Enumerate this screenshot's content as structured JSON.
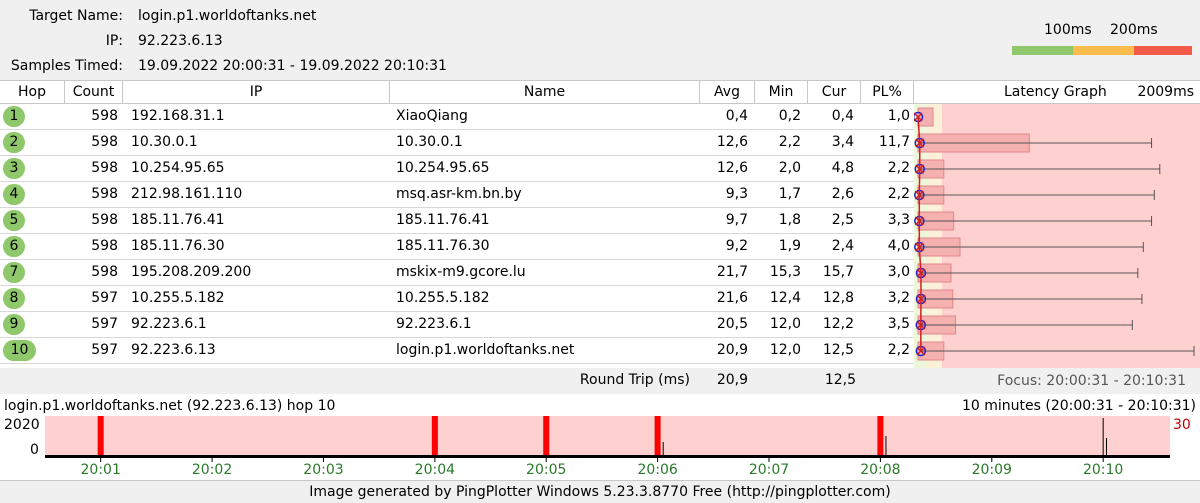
{
  "info": {
    "target_label": "Target Name:",
    "target_value": "login.p1.worldoftanks.net",
    "ip_label": "IP:",
    "ip_value": "92.223.6.13",
    "samples_label": "Samples Timed:",
    "samples_value": "19.09.2022 20:00:31 - 19.09.2022 20:10:31"
  },
  "scale": {
    "label_100": "100ms",
    "label_200": "200ms",
    "colors": {
      "green": "#8fc86a",
      "yellow": "#fbbc4c",
      "red": "#f25a4a"
    }
  },
  "headers": {
    "hop": "Hop",
    "count": "Count",
    "ip": "IP",
    "name": "Name",
    "avg": "Avg",
    "min": "Min",
    "cur": "Cur",
    "pl": "PL%",
    "graph": "Latency Graph",
    "graph_max": "2009ms"
  },
  "rows": [
    {
      "hop": "1",
      "count": "598",
      "ip": "192.168.31.1",
      "name": "XiaoQiang",
      "avg": "0,4",
      "min": "0,2",
      "cur": "0,4",
      "pl": "1,0",
      "pl_pct": 1.0,
      "avg_ms": 0.4,
      "cur_ms": 0.4,
      "max_ms": 0.4
    },
    {
      "hop": "2",
      "count": "598",
      "ip": "10.30.0.1",
      "name": "10.30.0.1",
      "avg": "12,6",
      "min": "2,2",
      "cur": "3,4",
      "pl": "11,7",
      "pl_pct": 11.7,
      "avg_ms": 12.6,
      "cur_ms": 3.4,
      "max_ms": 1700
    },
    {
      "hop": "3",
      "count": "598",
      "ip": "10.254.95.65",
      "name": "10.254.95.65",
      "avg": "12,6",
      "min": "2,0",
      "cur": "4,8",
      "pl": "2,2",
      "pl_pct": 2.2,
      "avg_ms": 12.6,
      "cur_ms": 4.8,
      "max_ms": 1760
    },
    {
      "hop": "4",
      "count": "598",
      "ip": "212.98.161.110",
      "name": "msq.asr-km.bn.by",
      "avg": "9,3",
      "min": "1,7",
      "cur": "2,6",
      "pl": "2,2",
      "pl_pct": 2.2,
      "avg_ms": 9.3,
      "cur_ms": 2.6,
      "max_ms": 1720
    },
    {
      "hop": "5",
      "count": "598",
      "ip": "185.11.76.41",
      "name": "185.11.76.41",
      "avg": "9,7",
      "min": "1,8",
      "cur": "2,5",
      "pl": "3,3",
      "pl_pct": 3.3,
      "avg_ms": 9.7,
      "cur_ms": 2.5,
      "max_ms": 1700
    },
    {
      "hop": "6",
      "count": "598",
      "ip": "185.11.76.30",
      "name": "185.11.76.30",
      "avg": "9,2",
      "min": "1,9",
      "cur": "2,4",
      "pl": "4,0",
      "pl_pct": 4.0,
      "avg_ms": 9.2,
      "cur_ms": 2.4,
      "max_ms": 1640
    },
    {
      "hop": "7",
      "count": "598",
      "ip": "195.208.209.200",
      "name": "mskix-m9.gcore.lu",
      "avg": "21,7",
      "min": "15,3",
      "cur": "15,7",
      "pl": "3,0",
      "pl_pct": 3.0,
      "avg_ms": 21.7,
      "cur_ms": 15.7,
      "max_ms": 1600
    },
    {
      "hop": "8",
      "count": "597",
      "ip": "10.255.5.182",
      "name": "10.255.5.182",
      "avg": "21,6",
      "min": "12,4",
      "cur": "12,8",
      "pl": "3,2",
      "pl_pct": 3.2,
      "avg_ms": 21.6,
      "cur_ms": 12.8,
      "max_ms": 1630
    },
    {
      "hop": "9",
      "count": "597",
      "ip": "92.223.6.1",
      "name": "92.223.6.1",
      "avg": "20,5",
      "min": "12,0",
      "cur": "12,2",
      "pl": "3,5",
      "pl_pct": 3.5,
      "avg_ms": 20.5,
      "cur_ms": 12.2,
      "max_ms": 1560
    },
    {
      "hop": "10",
      "count": "597",
      "ip": "92.223.6.13",
      "name": "login.p1.worldoftanks.net",
      "avg": "20,9",
      "min": "12,0",
      "cur": "12,5",
      "pl": "2,2",
      "pl_pct": 2.2,
      "avg_ms": 20.9,
      "cur_ms": 12.5,
      "max_ms": 2009
    }
  ],
  "graph": {
    "max_ms": 2009
  },
  "roundtrip": {
    "label": "Round Trip (ms)",
    "avg": "20,9",
    "cur": "12,5",
    "focus": "Focus: 20:00:31 - 20:10:31"
  },
  "timeline": {
    "title": "login.p1.worldoftanks.net (92.223.6.13) hop 10",
    "range": "10 minutes (20:00:31 - 20:10:31)",
    "y_top": "2020",
    "y_bottom": "0",
    "right_label": "30",
    "right_label_color": "#c00000",
    "ticks": [
      "20:01",
      "20:02",
      "20:03",
      "20:04",
      "20:05",
      "20:06",
      "20:07",
      "20:08",
      "20:09",
      "20:10"
    ],
    "loss_events_min": [
      0.5,
      3.5,
      4.5,
      5.5,
      7.5
    ],
    "spikes_min": [
      {
        "t": 5.55,
        "frac": 0.35
      },
      {
        "t": 7.55,
        "frac": 0.5
      },
      {
        "t": 9.5,
        "frac": 0.95
      },
      {
        "t": 9.53,
        "frac": 0.45
      }
    ]
  },
  "footer": "Image generated by PingPlotter Windows 5.23.3.8770 Free (http://pingplotter.com)"
}
